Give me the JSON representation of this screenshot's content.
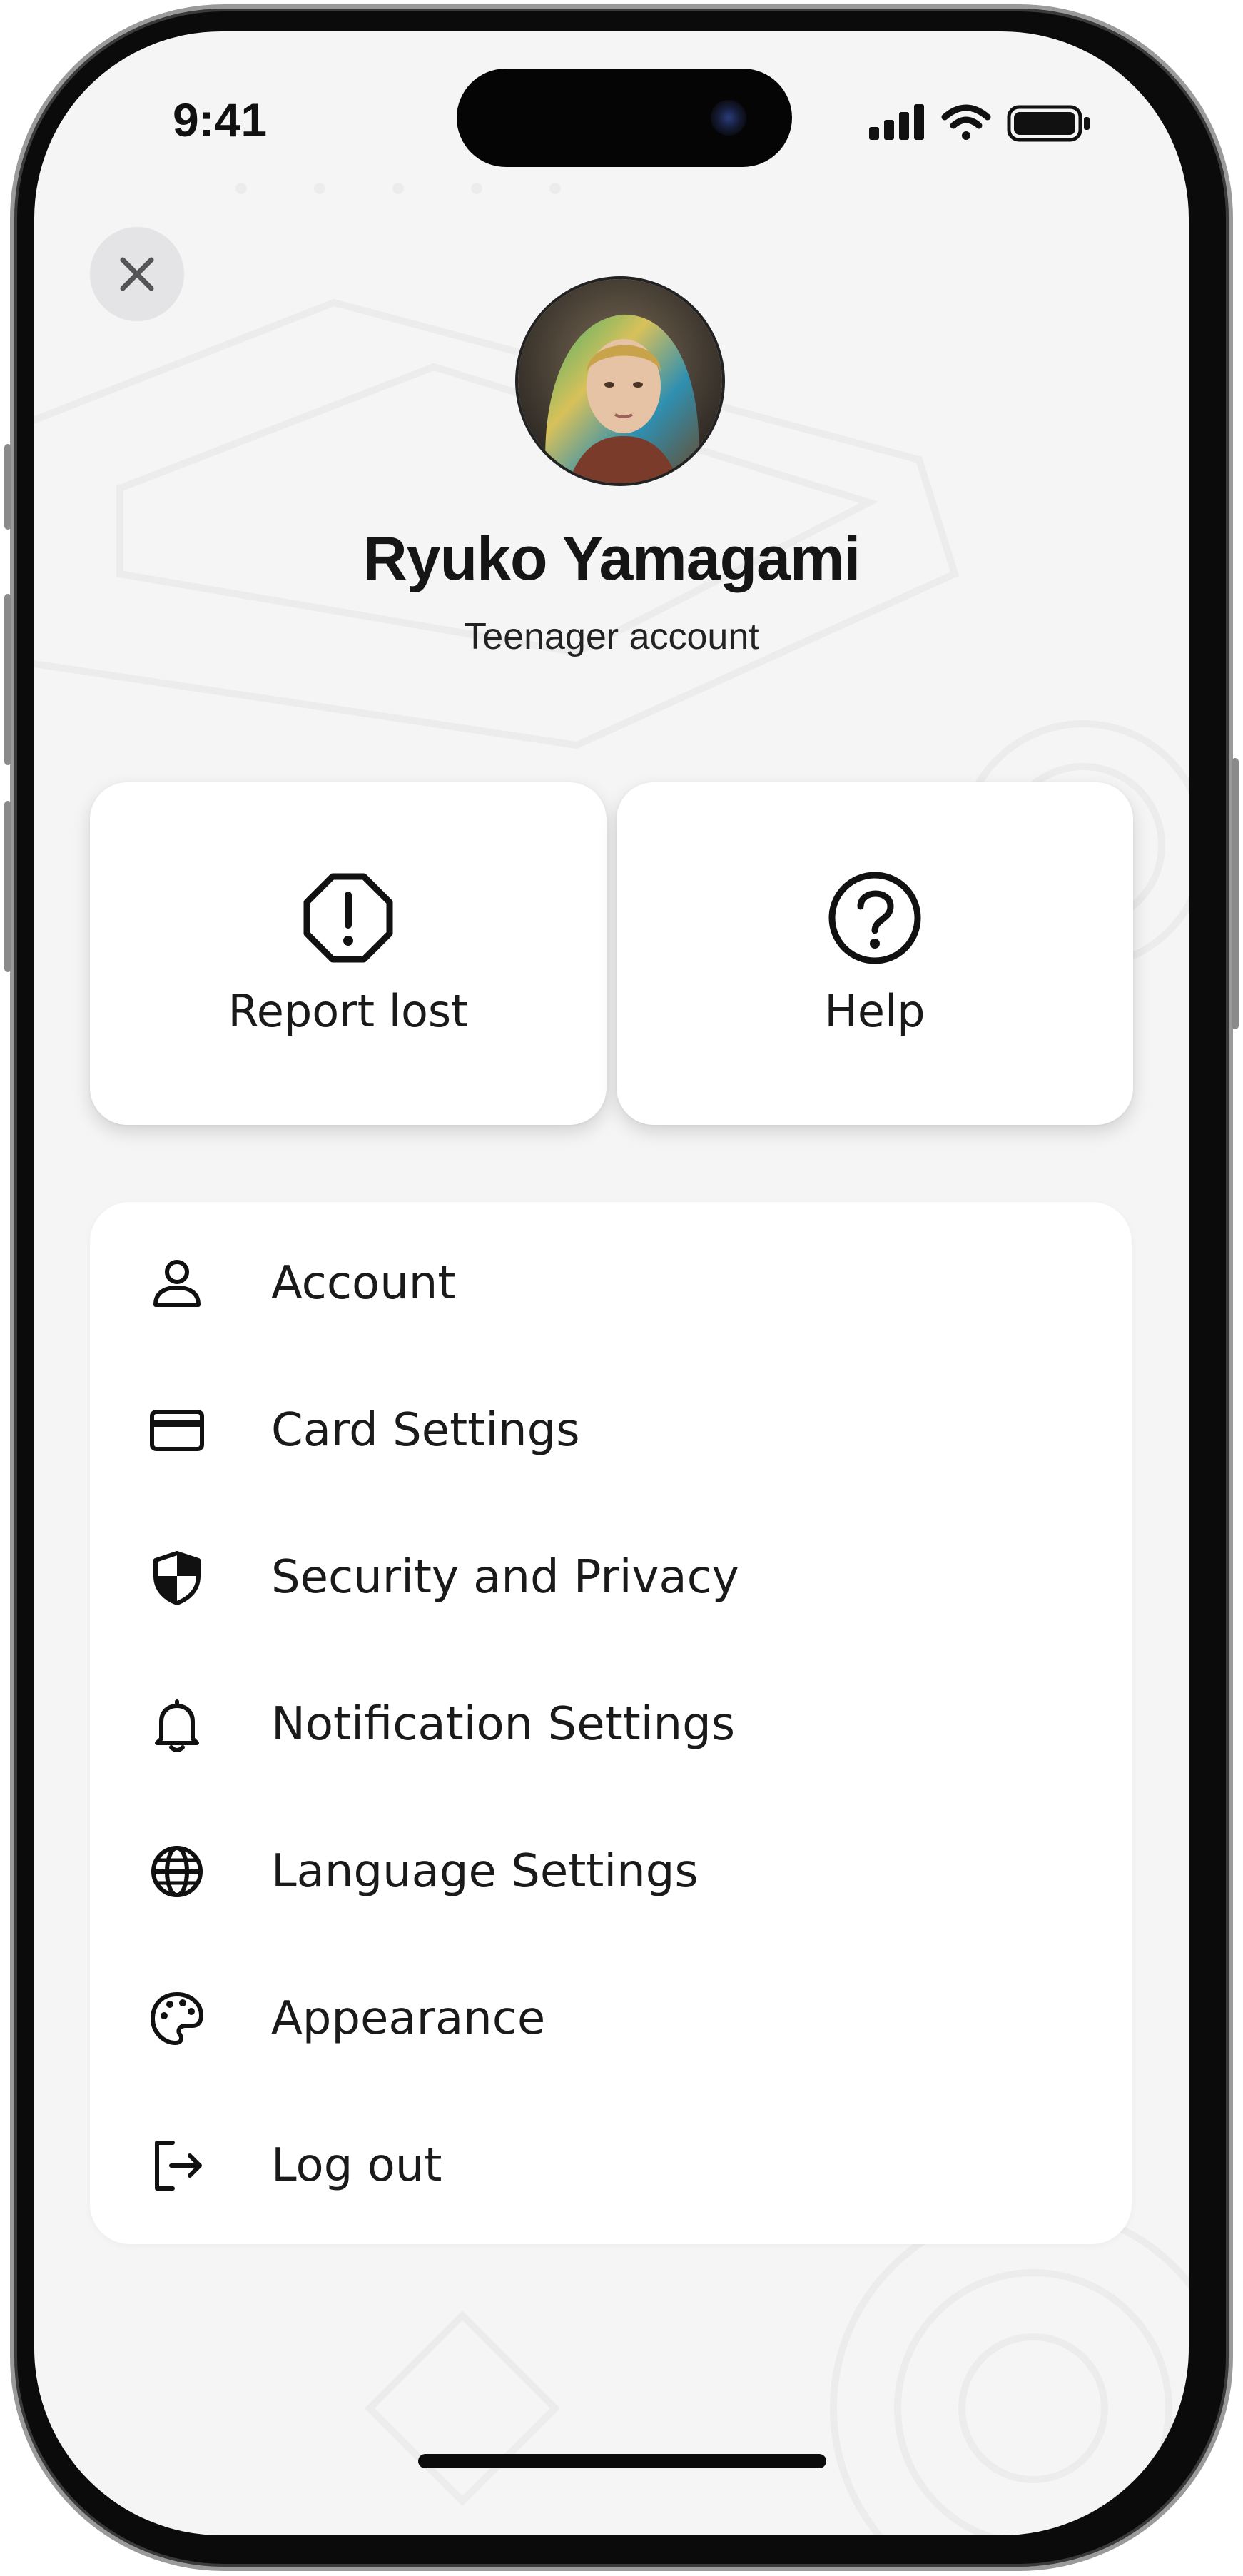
{
  "status_bar": {
    "time": "9:41",
    "icons": [
      "signal-icon",
      "wifi-icon",
      "battery-icon"
    ]
  },
  "header": {
    "close_icon": "close-icon",
    "user_name": "Ryuko Yamagami",
    "account_type": "Teenager account"
  },
  "quick_actions": [
    {
      "label": "Report lost",
      "icon": "alert-octagon-icon"
    },
    {
      "label": "Help",
      "icon": "help-circle-icon"
    }
  ],
  "menu": {
    "items": [
      {
        "label": "Account",
        "icon": "user-icon"
      },
      {
        "label": "Card Settings",
        "icon": "credit-card-icon"
      },
      {
        "label": "Security and Privacy",
        "icon": "shield-icon"
      },
      {
        "label": "Notification Settings",
        "icon": "bell-icon"
      },
      {
        "label": "Language Settings",
        "icon": "globe-icon"
      },
      {
        "label": "Appearance",
        "icon": "palette-icon"
      },
      {
        "label": "Log out",
        "icon": "logout-icon"
      }
    ]
  },
  "colors": {
    "background": "#f5f5f5",
    "card": "#ffffff",
    "text": "#1a1a1a",
    "close_button": "#e4e4e6"
  }
}
